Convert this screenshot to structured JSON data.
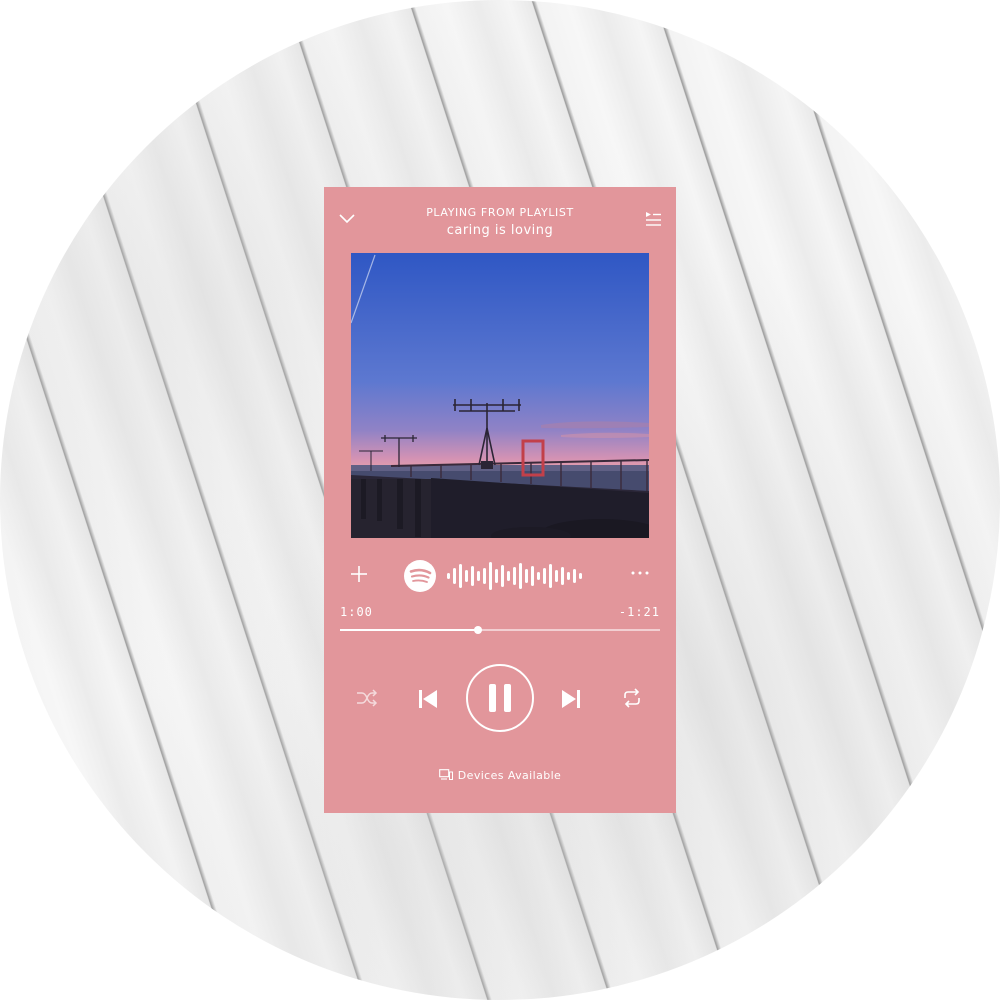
{
  "header": {
    "context_label": "PLAYING FROM PLAYLIST",
    "playlist_name": "caring is loving"
  },
  "icons": {
    "collapse": "chevron-down-icon",
    "queue": "queue-icon",
    "add": "plus-icon",
    "logo": "spotify-logo-icon",
    "more": "more-icon",
    "shuffle": "shuffle-icon",
    "previous": "skip-back-icon",
    "pause": "pause-icon",
    "next": "skip-forward-icon",
    "repeat": "repeat-icon",
    "devices": "devices-icon"
  },
  "playback": {
    "elapsed": "1:00",
    "remaining": "-1:21",
    "progress_fraction": 0.43
  },
  "footer": {
    "devices_label": "Devices Available"
  },
  "colors": {
    "card": "#e2969b",
    "foreground": "#ffffff"
  }
}
